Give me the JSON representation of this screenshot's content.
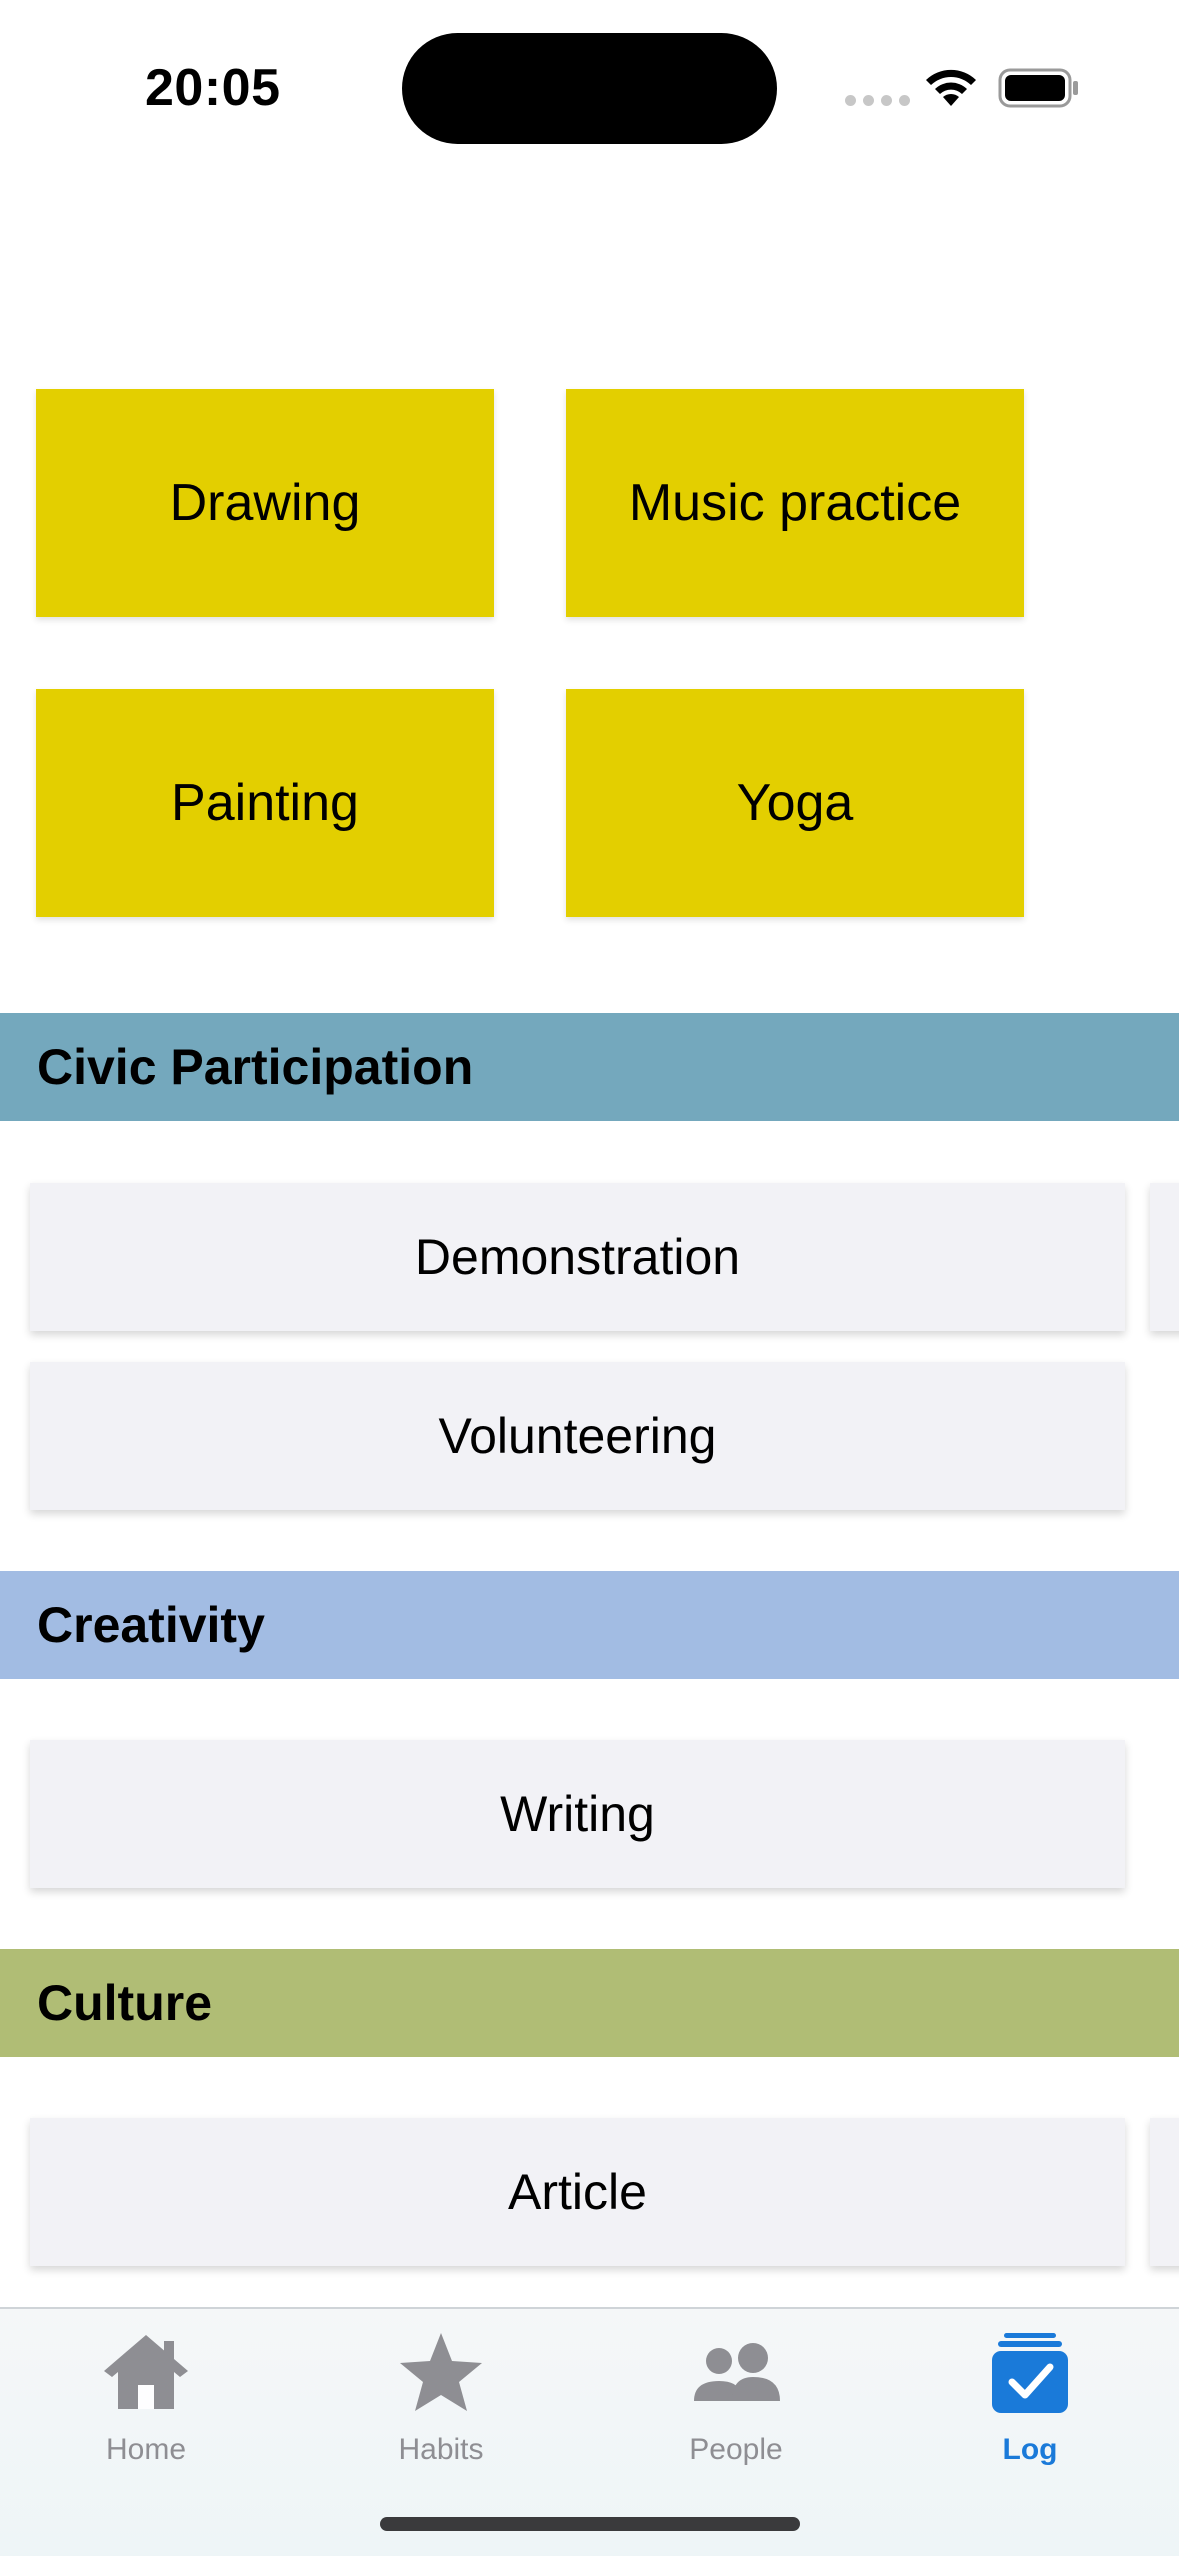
{
  "status_bar": {
    "time": "20:05"
  },
  "featured": [
    {
      "label": "Drawing"
    },
    {
      "label": "Music practice"
    },
    {
      "label": "Painting"
    },
    {
      "label": "Yoga"
    }
  ],
  "categories": [
    {
      "title": "Civic Participation",
      "color": "#74a8bd",
      "items": [
        "Demonstration",
        "Volunteering"
      ]
    },
    {
      "title": "Creativity",
      "color": "#a2bce3",
      "items": [
        "Writing"
      ]
    },
    {
      "title": "Culture",
      "color": "#b0bd75",
      "items": [
        "Article"
      ]
    }
  ],
  "tabbar": {
    "tabs": [
      {
        "label": "Home",
        "icon": "house-icon"
      },
      {
        "label": "Habits",
        "icon": "star-icon"
      },
      {
        "label": "People",
        "icon": "people-icon"
      },
      {
        "label": "Log",
        "icon": "checklist-icon"
      }
    ],
    "active": "Log",
    "active_color": "#1a7ad9",
    "inactive_color": "#8e8e93"
  },
  "colors": {
    "featured_tile": "#e3cf00",
    "card_bg": "#f2f2f6"
  }
}
